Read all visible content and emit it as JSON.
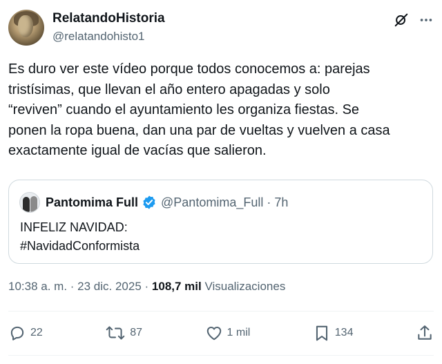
{
  "author": {
    "display_name": "RelatandoHistoria",
    "handle": "@relatandohisto1"
  },
  "tweet": {
    "lines": [
      "Es duro ver este vídeo porque todos conocemos a: parejas",
      "tristísimas, que llevan el año entero apagadas y solo",
      "“reviven” cuando el ayuntamiento les organiza fiestas. Se",
      "ponen la ropa buena, dan una par de vueltas y vuelven a casa",
      "exactamente igual de vacías que salieron."
    ]
  },
  "quote": {
    "display_name": "Pantomima Full",
    "handle_time": "@Pantomima_Full · 7h",
    "lines": [
      "INFELIZ NAVIDAD:",
      "#NavidadConformista"
    ]
  },
  "meta": {
    "timestamp": "10:38 a. m. · 23 dic. 2025 · ",
    "views_count": "108,7 mil",
    "views_label": " Visualizaciones"
  },
  "actions": {
    "replies": "22",
    "reposts": "87",
    "likes": "1 mil",
    "bookmarks": "134"
  },
  "colors": {
    "text_primary": "#0f1419",
    "text_secondary": "#536471",
    "verified_blue": "#1d9bf0",
    "border": "#cfd9de"
  },
  "icons": [
    "grok-icon",
    "more-icon",
    "verified-badge-icon",
    "reply-icon",
    "repost-icon",
    "like-icon",
    "bookmark-icon",
    "share-icon"
  ]
}
